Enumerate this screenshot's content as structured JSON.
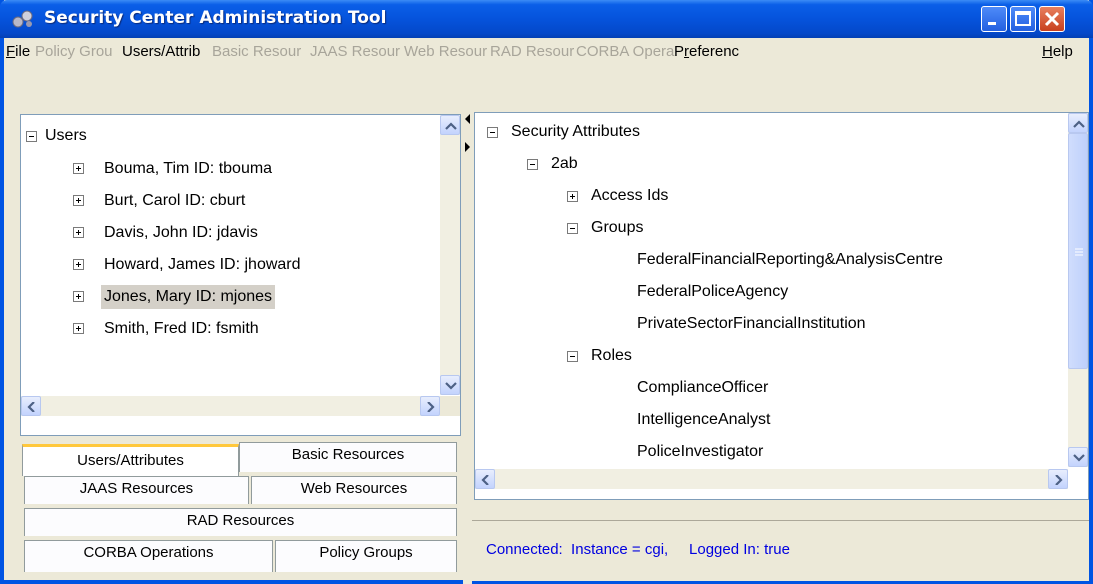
{
  "window": {
    "title": "Security Center Administration Tool"
  },
  "menu": [
    {
      "label": "File",
      "enabled": true,
      "underline": "F",
      "rest": "ile"
    },
    {
      "label": "Policy Grou",
      "enabled": false
    },
    {
      "label": "Users/Attrib",
      "enabled": true
    },
    {
      "label": "Basic Resour",
      "enabled": false
    },
    {
      "label": "JAAS Resour",
      "enabled": false
    },
    {
      "label": "Web Resour",
      "enabled": false
    },
    {
      "label": "RAD Resour",
      "enabled": false
    },
    {
      "label": "CORBA Opera",
      "enabled": false
    },
    {
      "label": "Preferenc",
      "enabled": true,
      "underline": "r",
      "prefix": "P",
      "rest": "eferenc"
    },
    {
      "label": "Help",
      "enabled": true,
      "underline": "H",
      "rest": "elp"
    }
  ],
  "users_tree": {
    "root": "Users",
    "items": [
      {
        "label": "Bouma, Tim   ID: tbouma",
        "selected": false
      },
      {
        "label": "Burt, Carol   ID: cburt",
        "selected": false
      },
      {
        "label": "Davis, John   ID: jdavis",
        "selected": false
      },
      {
        "label": "Howard, James   ID: jhoward",
        "selected": false
      },
      {
        "label": "Jones, Mary   ID: mjones",
        "selected": true
      },
      {
        "label": "Smith, Fred   ID: fsmith",
        "selected": false
      }
    ]
  },
  "tabs": {
    "row1": [
      "Users/Attributes",
      "Basic Resources"
    ],
    "row2": [
      "JAAS Resources",
      "Web Resources"
    ],
    "row3": [
      "RAD Resources"
    ],
    "row4": [
      "CORBA Operations",
      "Policy Groups"
    ],
    "active": "Users/Attributes"
  },
  "attributes_tree": {
    "root": "Security Attributes",
    "node": "2ab",
    "access_ids": "Access Ids",
    "groups_label": "Groups",
    "groups": [
      "FederalFinancialReporting&AnalysisCentre",
      "FederalPoliceAgency",
      "PrivateSectorFinancialInstitution"
    ],
    "roles_label": "Roles",
    "roles": [
      "ComplianceOfficer",
      "IntelligenceAnalyst",
      "PoliceInvestigator"
    ]
  },
  "status": {
    "text": "Connected:  Instance = cgi,     Logged In: true"
  },
  "colors": {
    "title_bar": "#0553DC",
    "status_text": "#0000E0",
    "active_tab": "#FFC83C"
  }
}
